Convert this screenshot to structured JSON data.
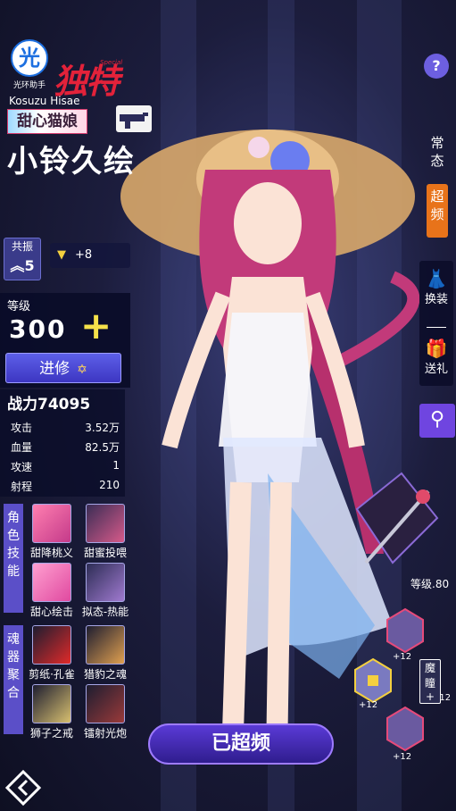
{
  "header": {
    "logo_char": "光",
    "logo_text": "光环助手",
    "special_text": "独特",
    "special_sup": "Special",
    "en_name": "Kosuzu Hisae",
    "title": "甜心猫娘",
    "cn_name": "小铃久绘"
  },
  "resonance": {
    "label": "共振",
    "value": "5",
    "bonus": "+8"
  },
  "level": {
    "label": "等级",
    "value": "300",
    "plus": "+",
    "advance_label": "进修"
  },
  "stats": {
    "power": "战力74095",
    "rows": [
      {
        "label": "攻击",
        "value": "3.52万"
      },
      {
        "label": "血量",
        "value": "82.5万"
      },
      {
        "label": "攻速",
        "value": "1"
      },
      {
        "label": "射程",
        "value": "210"
      }
    ]
  },
  "skills": {
    "tag": "角色技能",
    "items": [
      {
        "label": "甜降桃义"
      },
      {
        "label": "甜蜜投喂"
      },
      {
        "label": "甜心绘击"
      },
      {
        "label": "拟态-热能"
      }
    ]
  },
  "souls": {
    "tag": "魂器聚合",
    "items": [
      {
        "label": "剪纸·孔雀"
      },
      {
        "label": "猎豹之魂"
      },
      {
        "label": "狮子之戒"
      },
      {
        "label": "镭射光炮"
      }
    ]
  },
  "right": {
    "help": "?",
    "tab_normal": "常态",
    "tab_super": "超频",
    "dress_label": "换装",
    "gift_label": "送礼",
    "weapon_level": "等级.80",
    "demon_label": "魔瞳",
    "demon_plus": "+",
    "plus_labels": [
      "+12",
      "+12",
      "+12",
      "+12"
    ]
  },
  "footer": {
    "super_button": "已超频"
  },
  "colors": {
    "accent": "#5b4fc8",
    "level_plus": "#f6e14a",
    "special_red": "#e3223a",
    "super_tab": "#e8731a"
  }
}
